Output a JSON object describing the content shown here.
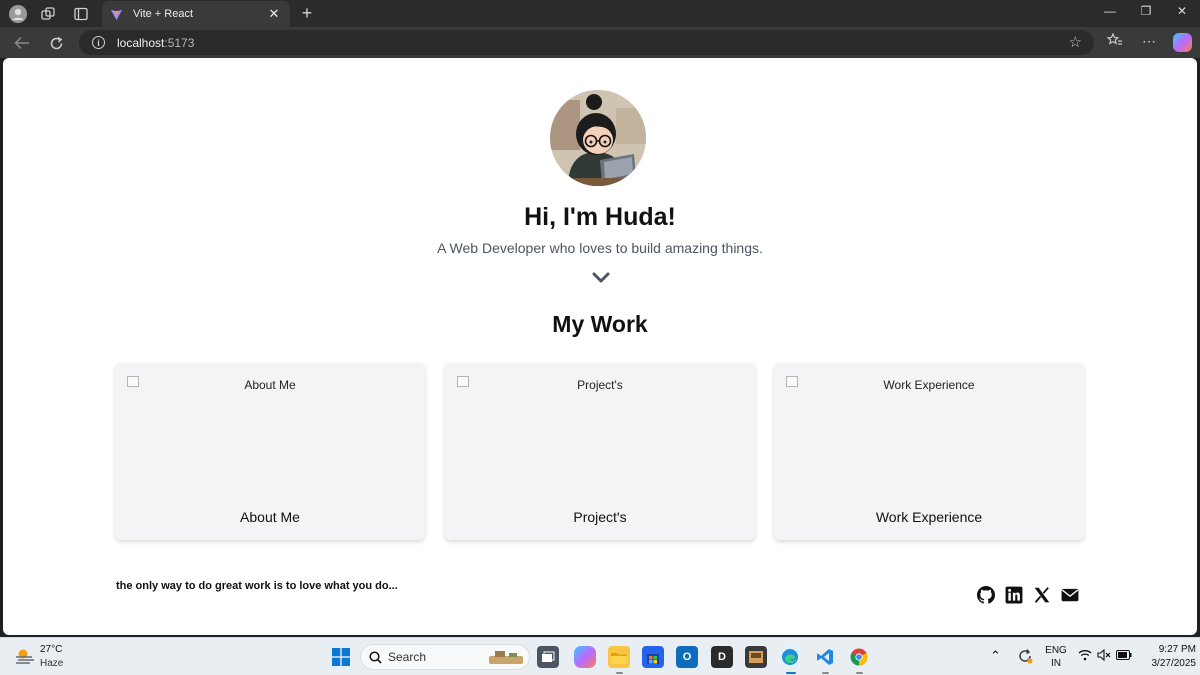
{
  "browser": {
    "tab_title": "Vite + React",
    "tab_close": "✕",
    "new_tab": "+",
    "address_host": "localhost",
    "address_port": ":5173",
    "window_controls": [
      "—",
      "❐",
      "✕"
    ]
  },
  "page": {
    "title": "Hi, I'm Huda!",
    "subtitle": "A Web Developer who loves to build amazing things.",
    "section_title": "My Work",
    "cards": [
      {
        "image_alt": "About Me",
        "label": "About Me"
      },
      {
        "image_alt": "Project's",
        "label": "Project's"
      },
      {
        "image_alt": "Work Experience",
        "label": "Work Experience"
      }
    ],
    "quote": "the only way to do great work is to love what you do...",
    "social_icons": [
      "github-icon",
      "linkedin-icon",
      "x-icon",
      "email-icon"
    ]
  },
  "taskbar": {
    "weather_temp": "27°C",
    "weather_condition": "Haze",
    "search_placeholder": "Search",
    "language_line1": "ENG",
    "language_line2": "IN",
    "time": "9:27 PM",
    "date": "3/27/2025"
  },
  "colors": {
    "chrome_dark": "#2b2b2b",
    "card_bg": "#f3f4f6",
    "subtitle_text": "#4b5563",
    "taskbar_bg": "#e9eef3"
  }
}
